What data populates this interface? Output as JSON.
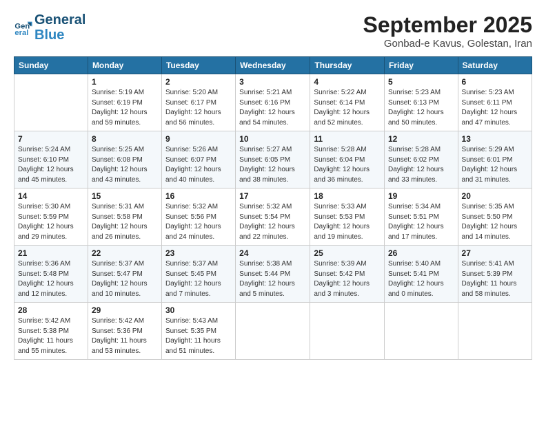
{
  "header": {
    "logo_line1": "General",
    "logo_line2": "Blue",
    "month_title": "September 2025",
    "location": "Gonbad-e Kavus, Golestan, Iran"
  },
  "weekdays": [
    "Sunday",
    "Monday",
    "Tuesday",
    "Wednesday",
    "Thursday",
    "Friday",
    "Saturday"
  ],
  "weeks": [
    [
      {
        "day": "",
        "info": ""
      },
      {
        "day": "1",
        "info": "Sunrise: 5:19 AM\nSunset: 6:19 PM\nDaylight: 12 hours\nand 59 minutes."
      },
      {
        "day": "2",
        "info": "Sunrise: 5:20 AM\nSunset: 6:17 PM\nDaylight: 12 hours\nand 56 minutes."
      },
      {
        "day": "3",
        "info": "Sunrise: 5:21 AM\nSunset: 6:16 PM\nDaylight: 12 hours\nand 54 minutes."
      },
      {
        "day": "4",
        "info": "Sunrise: 5:22 AM\nSunset: 6:14 PM\nDaylight: 12 hours\nand 52 minutes."
      },
      {
        "day": "5",
        "info": "Sunrise: 5:23 AM\nSunset: 6:13 PM\nDaylight: 12 hours\nand 50 minutes."
      },
      {
        "day": "6",
        "info": "Sunrise: 5:23 AM\nSunset: 6:11 PM\nDaylight: 12 hours\nand 47 minutes."
      }
    ],
    [
      {
        "day": "7",
        "info": "Sunrise: 5:24 AM\nSunset: 6:10 PM\nDaylight: 12 hours\nand 45 minutes."
      },
      {
        "day": "8",
        "info": "Sunrise: 5:25 AM\nSunset: 6:08 PM\nDaylight: 12 hours\nand 43 minutes."
      },
      {
        "day": "9",
        "info": "Sunrise: 5:26 AM\nSunset: 6:07 PM\nDaylight: 12 hours\nand 40 minutes."
      },
      {
        "day": "10",
        "info": "Sunrise: 5:27 AM\nSunset: 6:05 PM\nDaylight: 12 hours\nand 38 minutes."
      },
      {
        "day": "11",
        "info": "Sunrise: 5:28 AM\nSunset: 6:04 PM\nDaylight: 12 hours\nand 36 minutes."
      },
      {
        "day": "12",
        "info": "Sunrise: 5:28 AM\nSunset: 6:02 PM\nDaylight: 12 hours\nand 33 minutes."
      },
      {
        "day": "13",
        "info": "Sunrise: 5:29 AM\nSunset: 6:01 PM\nDaylight: 12 hours\nand 31 minutes."
      }
    ],
    [
      {
        "day": "14",
        "info": "Sunrise: 5:30 AM\nSunset: 5:59 PM\nDaylight: 12 hours\nand 29 minutes."
      },
      {
        "day": "15",
        "info": "Sunrise: 5:31 AM\nSunset: 5:58 PM\nDaylight: 12 hours\nand 26 minutes."
      },
      {
        "day": "16",
        "info": "Sunrise: 5:32 AM\nSunset: 5:56 PM\nDaylight: 12 hours\nand 24 minutes."
      },
      {
        "day": "17",
        "info": "Sunrise: 5:32 AM\nSunset: 5:54 PM\nDaylight: 12 hours\nand 22 minutes."
      },
      {
        "day": "18",
        "info": "Sunrise: 5:33 AM\nSunset: 5:53 PM\nDaylight: 12 hours\nand 19 minutes."
      },
      {
        "day": "19",
        "info": "Sunrise: 5:34 AM\nSunset: 5:51 PM\nDaylight: 12 hours\nand 17 minutes."
      },
      {
        "day": "20",
        "info": "Sunrise: 5:35 AM\nSunset: 5:50 PM\nDaylight: 12 hours\nand 14 minutes."
      }
    ],
    [
      {
        "day": "21",
        "info": "Sunrise: 5:36 AM\nSunset: 5:48 PM\nDaylight: 12 hours\nand 12 minutes."
      },
      {
        "day": "22",
        "info": "Sunrise: 5:37 AM\nSunset: 5:47 PM\nDaylight: 12 hours\nand 10 minutes."
      },
      {
        "day": "23",
        "info": "Sunrise: 5:37 AM\nSunset: 5:45 PM\nDaylight: 12 hours\nand 7 minutes."
      },
      {
        "day": "24",
        "info": "Sunrise: 5:38 AM\nSunset: 5:44 PM\nDaylight: 12 hours\nand 5 minutes."
      },
      {
        "day": "25",
        "info": "Sunrise: 5:39 AM\nSunset: 5:42 PM\nDaylight: 12 hours\nand 3 minutes."
      },
      {
        "day": "26",
        "info": "Sunrise: 5:40 AM\nSunset: 5:41 PM\nDaylight: 12 hours\nand 0 minutes."
      },
      {
        "day": "27",
        "info": "Sunrise: 5:41 AM\nSunset: 5:39 PM\nDaylight: 11 hours\nand 58 minutes."
      }
    ],
    [
      {
        "day": "28",
        "info": "Sunrise: 5:42 AM\nSunset: 5:38 PM\nDaylight: 11 hours\nand 55 minutes."
      },
      {
        "day": "29",
        "info": "Sunrise: 5:42 AM\nSunset: 5:36 PM\nDaylight: 11 hours\nand 53 minutes."
      },
      {
        "day": "30",
        "info": "Sunrise: 5:43 AM\nSunset: 5:35 PM\nDaylight: 11 hours\nand 51 minutes."
      },
      {
        "day": "",
        "info": ""
      },
      {
        "day": "",
        "info": ""
      },
      {
        "day": "",
        "info": ""
      },
      {
        "day": "",
        "info": ""
      }
    ]
  ]
}
